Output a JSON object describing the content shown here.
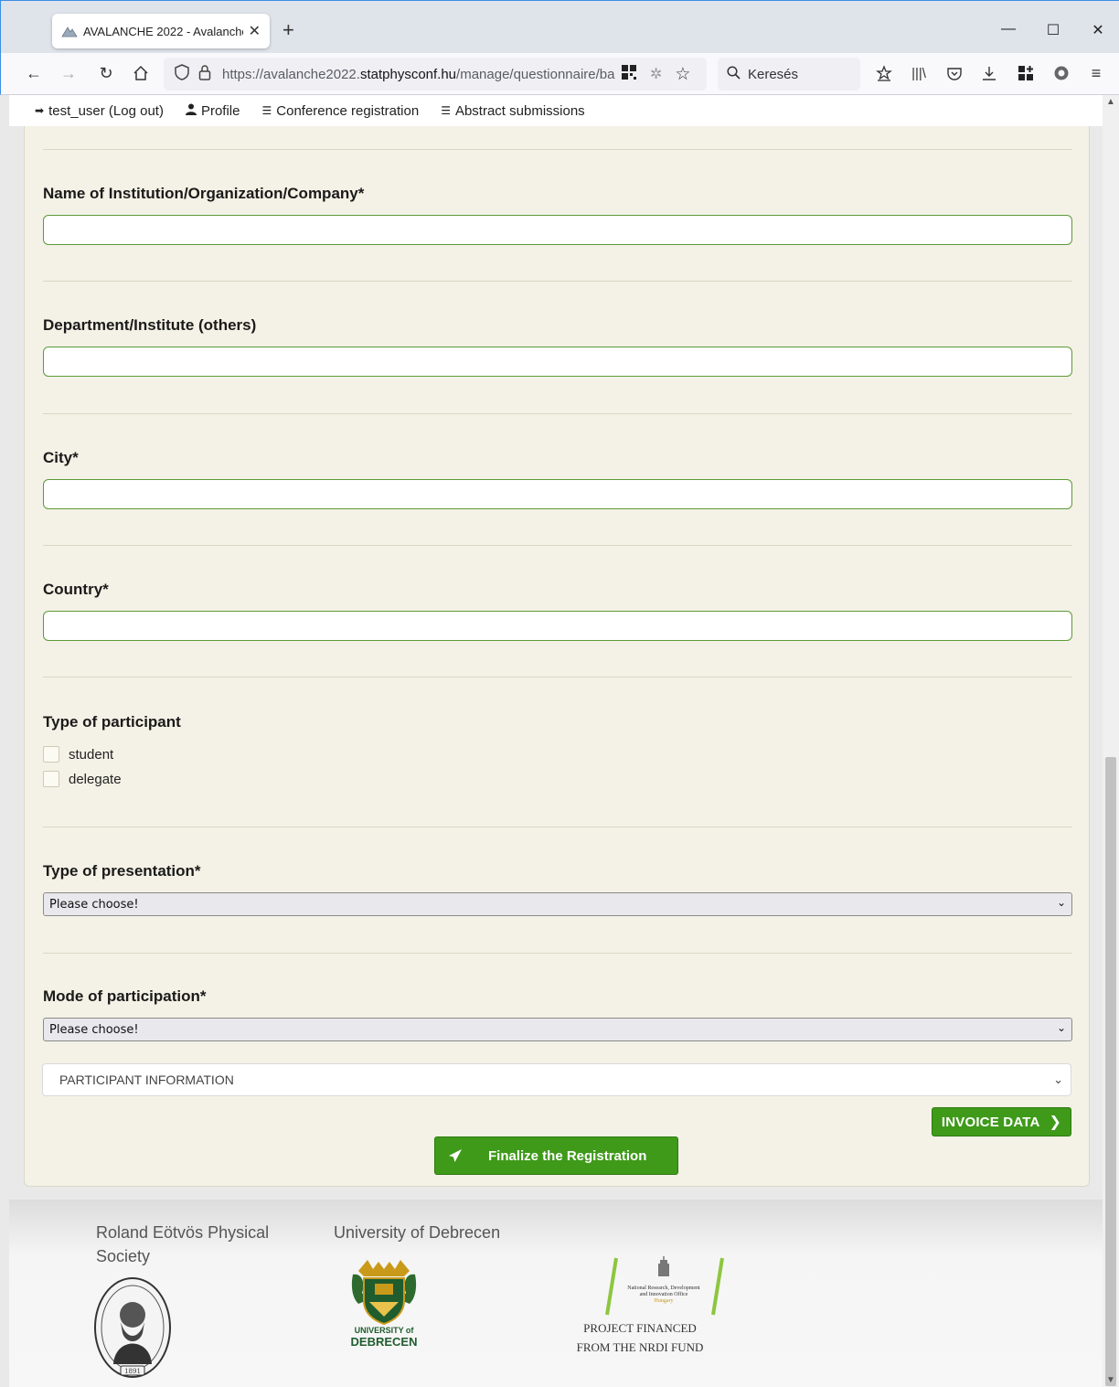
{
  "browser": {
    "tab_title": "AVALANCHE 2022 - Avalanche",
    "new_tab_symbol": "+",
    "url_prefix": "https://avalanche2022.",
    "url_domain": "statphysconf.hu",
    "url_path": "/manage/questionnaire/ba",
    "search_placeholder": "Keresés",
    "icons": [
      "back-icon",
      "forward-icon",
      "reload-icon",
      "home-icon",
      "shield-icon",
      "lock-icon",
      "qr-icon",
      "extension-icon",
      "star-icon",
      "search-icon",
      "reading-list-icon",
      "library-icon",
      "pocket-icon",
      "download-icon",
      "extensions-icon",
      "account-icon",
      "menu-icon"
    ]
  },
  "userbar": {
    "user": "test_user (Log out)",
    "profile": "Profile",
    "conference_registration": "Conference registration",
    "abstract_submissions": "Abstract submissions"
  },
  "form": {
    "institution_label": "Name of Institution/Organization/Company*",
    "institution_value": "",
    "department_label": "Department/Institute (others)",
    "department_value": "",
    "city_label": "City*",
    "city_value": "",
    "country_label": "Country*",
    "country_value": "",
    "participant_type_label": "Type of participant",
    "participant_options": [
      "student",
      "delegate"
    ],
    "presentation_label": "Type of presentation*",
    "presentation_value": "Please choose!",
    "mode_label": "Mode of participation*",
    "mode_value": "Please choose!",
    "section_select_value": "PARTICIPANT INFORMATION",
    "invoice_button": "INVOICE DATA",
    "finalize_button": "Finalize the Registration"
  },
  "footer": {
    "society_title": "Roland Eötvös Physical Society",
    "university_title": "University of Debrecen",
    "university_logo_text_top": "UNIVERSITY of",
    "university_logo_text_bottom": "DEBRECEN",
    "seal_year": "1891",
    "nrdi_small_lines": [
      "National Research, Development",
      "and Innovation Office",
      "Hungary"
    ],
    "nrdi_line1": "PROJECT FINANCED",
    "nrdi_line2": "FROM THE NRDI FUND"
  },
  "colors": {
    "accent_green": "#3f9a1a",
    "input_border": "#5c9a3a",
    "form_background": "#f4f2e6"
  }
}
